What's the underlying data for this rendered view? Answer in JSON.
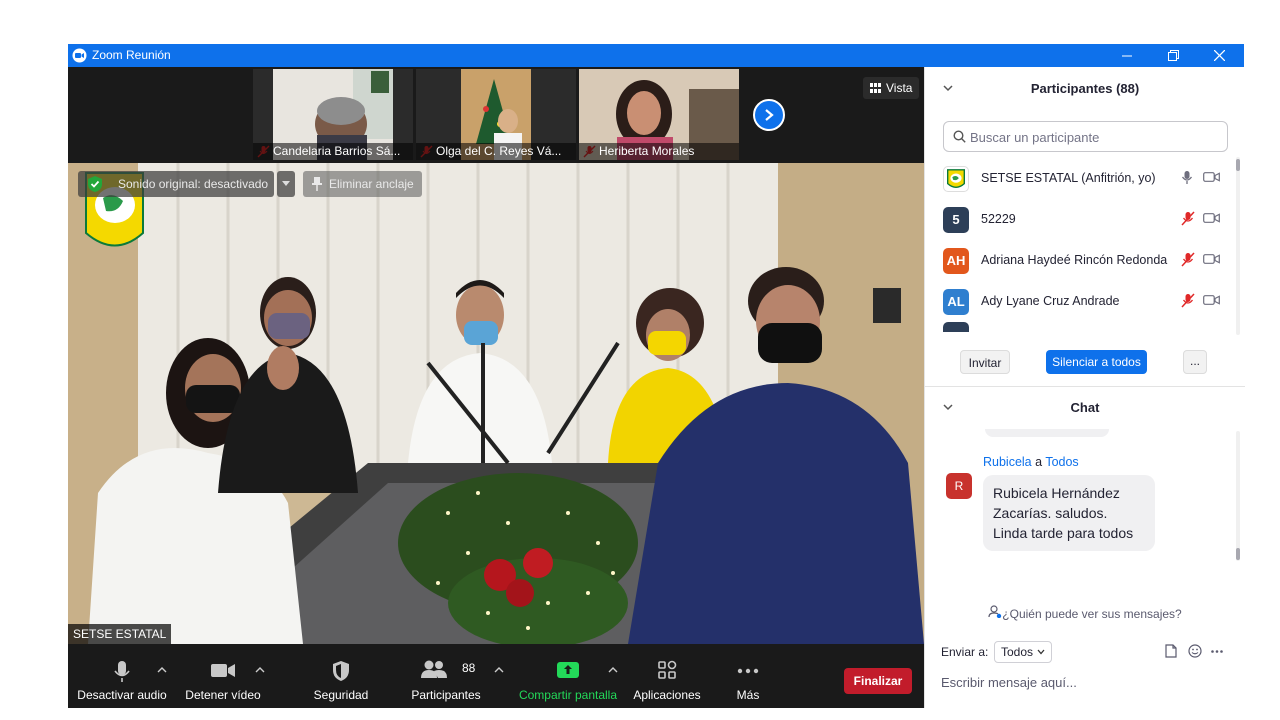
{
  "window": {
    "title": "Zoom Reunión"
  },
  "gallery": {
    "thumbnails": [
      {
        "name": "Candelaria Barrios Sá..."
      },
      {
        "name": "Olga del C. Reyes Vá..."
      },
      {
        "name": "Heriberta Morales"
      }
    ],
    "view_label": "Vista"
  },
  "video": {
    "original_sound": "Sonido original: desactivado",
    "unpin_label": "Eliminar anclaje",
    "speaker_name": "SETSE ESTATAL"
  },
  "toolbar": {
    "mute_label": "Desactivar audio",
    "video_label": "Detener vídeo",
    "security_label": "Seguridad",
    "participants_label": "Participantes",
    "participants_count": "88",
    "share_label": "Compartir pantalla",
    "apps_label": "Aplicaciones",
    "more_label": "Más",
    "end_label": "Finalizar"
  },
  "participants": {
    "title": "Participantes (88)",
    "search_placeholder": "Buscar un participante",
    "list": [
      {
        "initials": "",
        "name": "SETSE ESTATAL (Anfitrión, yo)",
        "color": "#ffffff",
        "mic": "on"
      },
      {
        "initials": "5",
        "name": "52229",
        "color": "#2d3f58",
        "mic": "muted"
      },
      {
        "initials": "AH",
        "name": "Adriana Haydeé Rincón Redonda",
        "color": "#e2571c",
        "mic": "muted"
      },
      {
        "initials": "AL",
        "name": "Ady Lyane Cruz Andrade",
        "color": "#2f7fcf",
        "mic": "muted"
      }
    ],
    "invite_label": "Invitar",
    "mute_all_label": "Silenciar a todos",
    "more_label": "..."
  },
  "chat": {
    "title": "Chat",
    "message": {
      "sender": "Rubicela",
      "connector": "a",
      "recipient": "Todos",
      "avatar_initial": "R",
      "lines": [
        "Rubicela Hernández",
        "Zacarías.  saludos.",
        "Linda tarde para todos"
      ]
    },
    "who_can_see": "¿Quién puede ver sus mensajes?",
    "send_to_label": "Enviar a:",
    "send_to_value": "Todos",
    "input_placeholder": "Escribir mensaje aquí..."
  },
  "colors": {
    "zoom_blue": "#0e71eb",
    "end_red": "#c21c2b",
    "share_green": "#23d959",
    "mute_red": "#e02828"
  }
}
